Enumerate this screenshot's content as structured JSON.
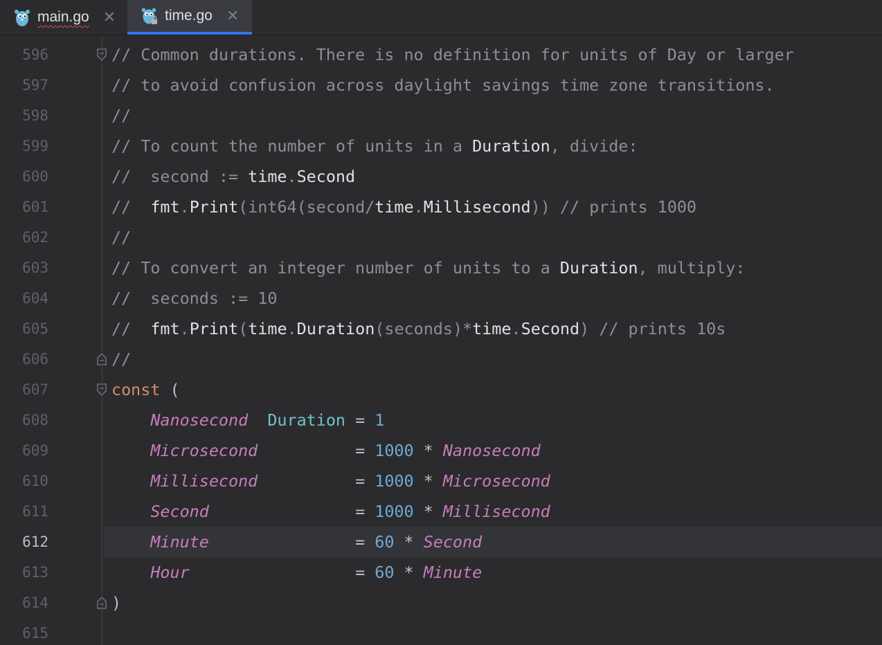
{
  "tabs": [
    {
      "label": "main.go",
      "active": false,
      "has_error": true
    },
    {
      "label": "time.go",
      "active": true,
      "read_only": true
    }
  ],
  "icons": {
    "tab_icon": "gopher-icon",
    "close": "close-icon",
    "fold": "fold-marker-icon"
  },
  "colors": {
    "background": "#2b2b2d",
    "active_tab_underline": "#3574f0",
    "comment": "#8c8f94",
    "keyword": "#cf8e6d",
    "constant": "#c77dbb",
    "type": "#6fc3c9",
    "number": "#6ea9d6"
  },
  "editor": {
    "current_line": "612",
    "lines": [
      {
        "n": "596",
        "segs": [
          {
            "t": "// Common durations. There is no definition for units of Day or larger",
            "c": "cmt"
          }
        ]
      },
      {
        "n": "597",
        "segs": [
          {
            "t": "// to avoid confusion across daylight savings time zone transitions.",
            "c": "cmt"
          }
        ]
      },
      {
        "n": "598",
        "segs": [
          {
            "t": "//",
            "c": "cmt"
          }
        ]
      },
      {
        "n": "599",
        "segs": [
          {
            "t": "// To count the number of units in a ",
            "c": "cmt"
          },
          {
            "t": "Duration",
            "c": "cmt-code"
          },
          {
            "t": ", divide:",
            "c": "cmt"
          }
        ]
      },
      {
        "n": "600",
        "segs": [
          {
            "t": "//  second := ",
            "c": "cmt"
          },
          {
            "t": "time",
            "c": "cmt-code"
          },
          {
            "t": ".",
            "c": "cmt"
          },
          {
            "t": "Second",
            "c": "cmt-code"
          }
        ]
      },
      {
        "n": "601",
        "segs": [
          {
            "t": "//  ",
            "c": "cmt"
          },
          {
            "t": "fmt",
            "c": "cmt-code"
          },
          {
            "t": ".",
            "c": "cmt"
          },
          {
            "t": "Print",
            "c": "cmt-code"
          },
          {
            "t": "(int64(second/",
            "c": "cmt"
          },
          {
            "t": "time",
            "c": "cmt-code"
          },
          {
            "t": ".",
            "c": "cmt"
          },
          {
            "t": "Millisecond",
            "c": "cmt-code"
          },
          {
            "t": ")) // prints 1000",
            "c": "cmt"
          }
        ]
      },
      {
        "n": "602",
        "segs": [
          {
            "t": "//",
            "c": "cmt"
          }
        ]
      },
      {
        "n": "603",
        "segs": [
          {
            "t": "// To convert an integer number of units to a ",
            "c": "cmt"
          },
          {
            "t": "Duration",
            "c": "cmt-code"
          },
          {
            "t": ", multiply:",
            "c": "cmt"
          }
        ]
      },
      {
        "n": "604",
        "segs": [
          {
            "t": "//  seconds := 10",
            "c": "cmt"
          }
        ]
      },
      {
        "n": "605",
        "segs": [
          {
            "t": "//  ",
            "c": "cmt"
          },
          {
            "t": "fmt",
            "c": "cmt-code"
          },
          {
            "t": ".",
            "c": "cmt"
          },
          {
            "t": "Print",
            "c": "cmt-code"
          },
          {
            "t": "(",
            "c": "cmt"
          },
          {
            "t": "time",
            "c": "cmt-code"
          },
          {
            "t": ".",
            "c": "cmt"
          },
          {
            "t": "Duration",
            "c": "cmt-code"
          },
          {
            "t": "(seconds)*",
            "c": "cmt"
          },
          {
            "t": "time",
            "c": "cmt-code"
          },
          {
            "t": ".",
            "c": "cmt"
          },
          {
            "t": "Second",
            "c": "cmt-code"
          },
          {
            "t": ") // prints 10s",
            "c": "cmt"
          }
        ]
      },
      {
        "n": "606",
        "segs": [
          {
            "t": "//",
            "c": "cmt"
          }
        ]
      },
      {
        "n": "607",
        "segs": [
          {
            "t": "const",
            "c": "kw"
          },
          {
            "t": " (",
            "c": "op"
          }
        ]
      },
      {
        "n": "608",
        "segs": [
          {
            "t": "    ",
            "c": "op"
          },
          {
            "t": "Nanosecond",
            "c": "const"
          },
          {
            "t": "  ",
            "c": "op"
          },
          {
            "t": "Duration",
            "c": "type"
          },
          {
            "t": " = ",
            "c": "op"
          },
          {
            "t": "1",
            "c": "num"
          }
        ]
      },
      {
        "n": "609",
        "segs": [
          {
            "t": "    ",
            "c": "op"
          },
          {
            "t": "Microsecond",
            "c": "const"
          },
          {
            "t": "          = ",
            "c": "op"
          },
          {
            "t": "1000",
            "c": "num"
          },
          {
            "t": " * ",
            "c": "op"
          },
          {
            "t": "Nanosecond",
            "c": "const"
          }
        ]
      },
      {
        "n": "610",
        "segs": [
          {
            "t": "    ",
            "c": "op"
          },
          {
            "t": "Millisecond",
            "c": "const"
          },
          {
            "t": "          = ",
            "c": "op"
          },
          {
            "t": "1000",
            "c": "num"
          },
          {
            "t": " * ",
            "c": "op"
          },
          {
            "t": "Microsecond",
            "c": "const"
          }
        ]
      },
      {
        "n": "611",
        "segs": [
          {
            "t": "    ",
            "c": "op"
          },
          {
            "t": "Second",
            "c": "const"
          },
          {
            "t": "               = ",
            "c": "op"
          },
          {
            "t": "1000",
            "c": "num"
          },
          {
            "t": " * ",
            "c": "op"
          },
          {
            "t": "Millisecond",
            "c": "const"
          }
        ]
      },
      {
        "n": "612",
        "segs": [
          {
            "t": "    ",
            "c": "op"
          },
          {
            "t": "Minute",
            "c": "const"
          },
          {
            "t": "               = ",
            "c": "op"
          },
          {
            "t": "60",
            "c": "num"
          },
          {
            "t": " * ",
            "c": "op"
          },
          {
            "t": "Second",
            "c": "const"
          }
        ]
      },
      {
        "n": "613",
        "segs": [
          {
            "t": "    ",
            "c": "op"
          },
          {
            "t": "Hour",
            "c": "const"
          },
          {
            "t": "                 = ",
            "c": "op"
          },
          {
            "t": "60",
            "c": "num"
          },
          {
            "t": " * ",
            "c": "op"
          },
          {
            "t": "Minute",
            "c": "const"
          }
        ]
      },
      {
        "n": "614",
        "segs": [
          {
            "t": ")",
            "c": "op"
          }
        ]
      },
      {
        "n": "615",
        "segs": []
      }
    ]
  }
}
